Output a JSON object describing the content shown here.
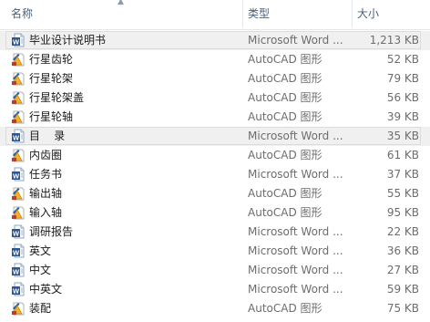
{
  "header": {
    "name_label": "名称",
    "type_label": "类型",
    "size_label": "大小"
  },
  "files": [
    {
      "name": "毕业设计说明书",
      "type": "Microsoft Word ...",
      "size": "1,213 KB",
      "icon": "word-document-icon",
      "selected": true
    },
    {
      "name": "行星齿轮",
      "type": "AutoCAD 图形",
      "size": "52 KB",
      "icon": "autocad-drawing-icon",
      "selected": false
    },
    {
      "name": "行星轮架",
      "type": "AutoCAD 图形",
      "size": "79 KB",
      "icon": "autocad-drawing-icon",
      "selected": false
    },
    {
      "name": "行星轮架盖",
      "type": "AutoCAD 图形",
      "size": "56 KB",
      "icon": "autocad-drawing-icon",
      "selected": false
    },
    {
      "name": "行星轮轴",
      "type": "AutoCAD 图形",
      "size": "39 KB",
      "icon": "autocad-drawing-icon",
      "selected": false
    },
    {
      "name": "目    录",
      "type": "Microsoft Word ...",
      "size": "35 KB",
      "icon": "word-document-icon",
      "selected": true
    },
    {
      "name": "内齿圈",
      "type": "AutoCAD 图形",
      "size": "61 KB",
      "icon": "autocad-drawing-icon",
      "selected": false
    },
    {
      "name": "任务书",
      "type": "Microsoft Word ...",
      "size": "37 KB",
      "icon": "word-document-icon",
      "selected": false
    },
    {
      "name": "输出轴",
      "type": "AutoCAD 图形",
      "size": "55 KB",
      "icon": "autocad-drawing-icon",
      "selected": false
    },
    {
      "name": "输入轴",
      "type": "AutoCAD 图形",
      "size": "95 KB",
      "icon": "autocad-drawing-icon",
      "selected": false
    },
    {
      "name": "调研报告",
      "type": "Microsoft Word ...",
      "size": "22 KB",
      "icon": "word-document-icon",
      "selected": false
    },
    {
      "name": "英文",
      "type": "Microsoft Word ...",
      "size": "36 KB",
      "icon": "word-document-icon",
      "selected": false
    },
    {
      "name": "中文",
      "type": "Microsoft Word ...",
      "size": "27 KB",
      "icon": "word-document-icon",
      "selected": false
    },
    {
      "name": "中英文",
      "type": "Microsoft Word ...",
      "size": "59 KB",
      "icon": "word-document-icon",
      "selected": false
    },
    {
      "name": "装配",
      "type": "AutoCAD 图形",
      "size": "75 KB",
      "icon": "autocad-drawing-icon",
      "selected": false
    }
  ],
  "colors": {
    "word_blue": "#2b5797",
    "autocad_yellow": "#f2b134",
    "autocad_red": "#c0392b",
    "selection_bg": "#f0f0f0",
    "header_text": "#4c607a",
    "secondary_text": "#6d6d6d"
  }
}
